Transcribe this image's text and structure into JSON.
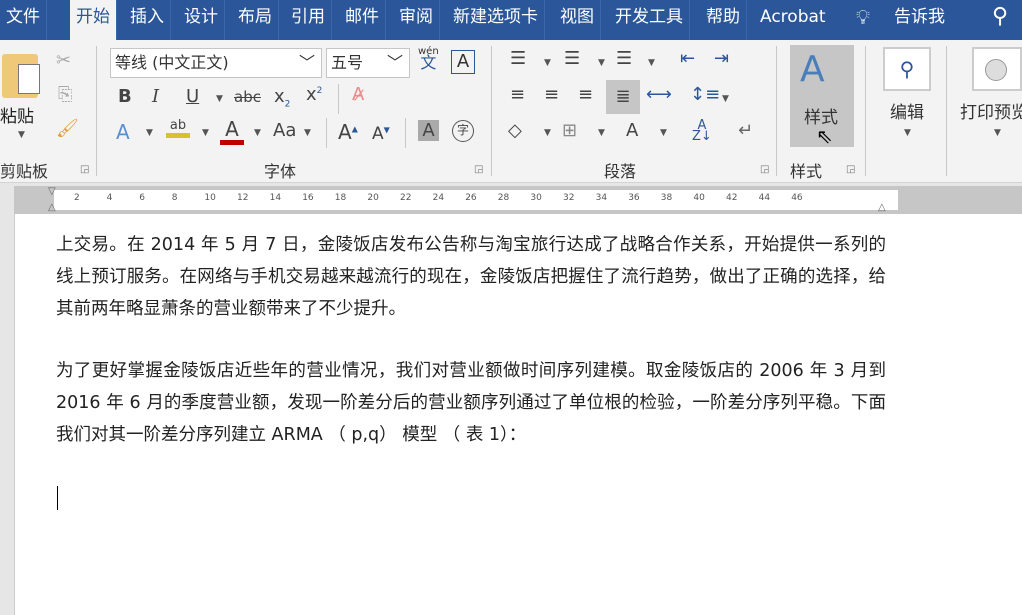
{
  "tabs": [
    "文件",
    "开始",
    "插入",
    "设计",
    "布局",
    "引用",
    "邮件",
    "审阅",
    "新建选项卡",
    "视图",
    "开发工具",
    "帮助",
    "Acrobat"
  ],
  "tell_me": "告诉我",
  "clipboard": {
    "paste": "粘贴",
    "group": "剪贴板"
  },
  "font": {
    "name": "等线 (中文正文)",
    "size": "五号",
    "group": "字体",
    "pinyin_top": "wén",
    "pinyin_bottom": "文"
  },
  "paragraph": {
    "group": "段落"
  },
  "styles": {
    "button": "样式",
    "group": "样式"
  },
  "editing": {
    "button": "编辑"
  },
  "print_preview": {
    "button": "打印预览"
  },
  "ruler": [
    "2",
    "4",
    "6",
    "8",
    "10",
    "12",
    "14",
    "16",
    "18",
    "20",
    "22",
    "24",
    "26",
    "28",
    "30",
    "32",
    "34",
    "36",
    "38",
    "40",
    "42",
    "44",
    "46"
  ],
  "colors": {
    "accent": "#2b579a",
    "highlight": "#d4c134",
    "font_color": "#c00000"
  },
  "document": {
    "paragraphs": [
      "上交易。在 2014 年 5 月 7 日，金陵饭店发布公告称与淘宝旅行达成了战略合作关系，开始提供一系列的线上预订服务。在网络与手机交易越来越流行的现在，金陵饭店把握住了流行趋势，做出了正确的选择，给其前两年略显萧条的营业额带来了不少提升。",
      "为了更好掌握金陵饭店近些年的营业情况，我们对营业额做时间序列建模。取金陵饭店的 2006 年 3 月到 2016 年 6 月的季度营业额，发现一阶差分后的营业额序列通过了单位根的检验，一阶差分序列平稳。下面我们对其一阶差分序列建立 ARMA （ p,q） 模型 （ 表 1）："
    ]
  }
}
